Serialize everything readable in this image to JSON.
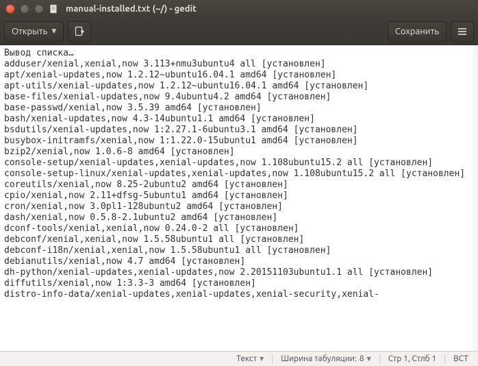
{
  "window": {
    "title": "manual-installed.txt (~/) - gedit"
  },
  "toolbar": {
    "open_label": "Открыть",
    "save_label": "Сохранить"
  },
  "editor": {
    "content": "Вывод списка…\nadduser/xenial,xenial,now 3.113+nmu3ubuntu4 all [установлен]\napt/xenial-updates,now 1.2.12~ubuntu16.04.1 amd64 [установлен]\napt-utils/xenial-updates,now 1.2.12~ubuntu16.04.1 amd64 [установлен]\nbase-files/xenial-updates,now 9.4ubuntu4.2 amd64 [установлен]\nbase-passwd/xenial,now 3.5.39 amd64 [установлен]\nbash/xenial-updates,now 4.3-14ubuntu1.1 amd64 [установлен]\nbsdutils/xenial-updates,now 1:2.27.1-6ubuntu3.1 amd64 [установлен]\nbusybox-initramfs/xenial,now 1:1.22.0-15ubuntu1 amd64 [установлен]\nbzip2/xenial,now 1.0.6-8 amd64 [установлен]\nconsole-setup/xenial-updates,xenial-updates,now 1.108ubuntu15.2 all [установлен]\nconsole-setup-linux/xenial-updates,xenial-updates,now 1.108ubuntu15.2 all [установлен]\ncoreutils/xenial,now 8.25-2ubuntu2 amd64 [установлен]\ncpio/xenial,now 2.11+dfsg-5ubuntu1 amd64 [установлен]\ncron/xenial,now 3.0pl1-128ubuntu2 amd64 [установлен]\ndash/xenial,now 0.5.8-2.1ubuntu2 amd64 [установлен]\ndconf-tools/xenial,xenial,now 0.24.0-2 all [установлен]\ndebconf/xenial,xenial,now 1.5.58ubuntu1 all [установлен]\ndebconf-i18n/xenial,xenial,now 1.5.58ubuntu1 all [установлен]\ndebianutils/xenial,now 4.7 amd64 [установлен]\ndh-python/xenial-updates,xenial-updates,now 2.20151103ubuntu1.1 all [установлен]\ndiffutils/xenial,now 1:3.3-3 amd64 [установлен]\ndistro-info-data/xenial-updates,xenial-updates,xenial-security,xenial-"
  },
  "statusbar": {
    "highlight_label": "Текст",
    "tabwidth_label": "Ширина табуляции:",
    "tabwidth_value": "8",
    "position": "Стр 1, Стлб 1",
    "insert_mode": "ВСТ"
  }
}
